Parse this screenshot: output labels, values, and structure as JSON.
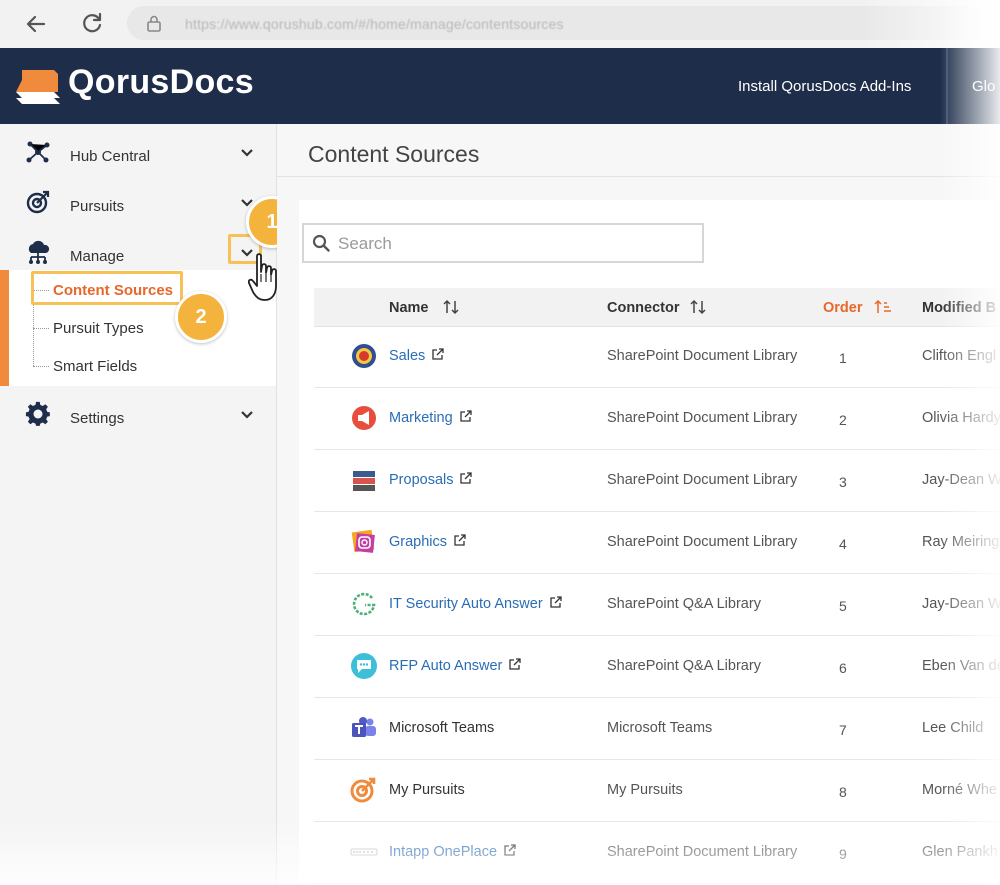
{
  "browser": {
    "url": "https://www.qorushub.com/#/home/manage/contentsources"
  },
  "header": {
    "logo_text": "QorusDocs",
    "install_link": "Install QorusDocs Add-Ins",
    "second_link": "Glo"
  },
  "sidebar": {
    "items": [
      {
        "label": "Hub Central",
        "icon": "hub-network-icon"
      },
      {
        "label": "Pursuits",
        "icon": "target-icon"
      },
      {
        "label": "Manage",
        "icon": "cloud-network-icon"
      },
      {
        "label": "Settings",
        "icon": "gear-icon"
      }
    ],
    "submenu": [
      {
        "label": "Content Sources",
        "active": true
      },
      {
        "label": "Pursuit Types"
      },
      {
        "label": "Smart Fields"
      }
    ]
  },
  "callouts": [
    "1",
    "2"
  ],
  "main": {
    "title": "Content Sources",
    "search_placeholder": "Search",
    "columns": {
      "name": "Name",
      "connector": "Connector",
      "order": "Order",
      "modified": "Modified B"
    },
    "rows": [
      {
        "name": "Sales",
        "connector": "SharePoint Document Library",
        "order": "1",
        "modified": "Clifton Engl",
        "link": true,
        "icon": "sales-badge-icon"
      },
      {
        "name": "Marketing",
        "connector": "SharePoint Document Library",
        "order": "2",
        "modified": "Olivia Hardy",
        "link": true,
        "icon": "megaphone-icon"
      },
      {
        "name": "Proposals",
        "connector": "SharePoint Document Library",
        "order": "3",
        "modified": "Jay-Dean W",
        "link": true,
        "icon": "proposals-stack-icon"
      },
      {
        "name": "Graphics",
        "connector": "SharePoint Document Library",
        "order": "4",
        "modified": "Ray Meiring",
        "link": true,
        "icon": "graphics-frames-icon"
      },
      {
        "name": "IT Security Auto Answer",
        "connector": "SharePoint Q&A Library",
        "order": "5",
        "modified": "Jay-Dean W",
        "link": true,
        "icon": "g-logo-icon"
      },
      {
        "name": "RFP Auto Answer",
        "connector": "SharePoint Q&A Library",
        "order": "6",
        "modified": "Eben Van de",
        "link": true,
        "icon": "chat-bubble-icon"
      },
      {
        "name": "Microsoft Teams",
        "connector": "Microsoft Teams",
        "order": "7",
        "modified": "Lee Child",
        "link": false,
        "icon": "teams-icon"
      },
      {
        "name": "My Pursuits",
        "connector": "My Pursuits",
        "order": "8",
        "modified": "Morné Whe",
        "link": false,
        "icon": "target-orange-icon"
      },
      {
        "name": "Intapp OnePlace",
        "connector": "SharePoint Document Library",
        "order": "9",
        "modified": "Glen Pankh",
        "link": true,
        "icon": "intapp-logo-icon"
      }
    ]
  },
  "colors": {
    "header_bg": "#1e2e4a",
    "accent_orange": "#e8672a",
    "callout": "#f4b33d",
    "link_blue": "#2a6db5"
  }
}
